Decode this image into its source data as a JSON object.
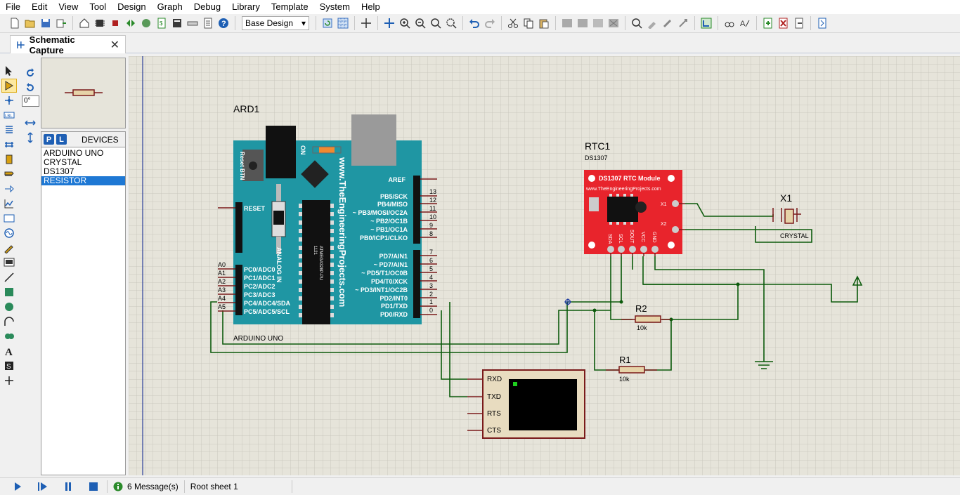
{
  "menu": [
    "File",
    "Edit",
    "View",
    "Tool",
    "Design",
    "Graph",
    "Debug",
    "Library",
    "Template",
    "System",
    "Help"
  ],
  "toolbar": {
    "design_select": "Base Design"
  },
  "tab": {
    "label": "Schematic Capture",
    "close": "✕"
  },
  "rotation": {
    "value": "0°"
  },
  "devices": {
    "p_label": "P",
    "l_label": "L",
    "header": "DEVICES",
    "items": [
      "ARDUINO UNO",
      "CRYSTAL",
      "DS1307",
      "RESISTOR"
    ],
    "selected": "RESISTOR"
  },
  "schematic": {
    "arduino": {
      "ref": "ARD1",
      "name": "ARDUINO UNO",
      "brand": "www.TheEngineeringProjects.com",
      "reset_btn": "Reset BTN",
      "on": "ON",
      "analog_in": "ANALOG IN",
      "chip": "ATMEGA328P-PU",
      "chip_num": "1121",
      "reset": "RESET",
      "aref": "AREF",
      "analog_pins": [
        "A0",
        "A1",
        "A2",
        "A3",
        "A4",
        "A5"
      ],
      "analog_labels": [
        "PC0/ADC0",
        "PC1/ADC1",
        "PC2/ADC2",
        "PC3/ADC3",
        "PC4/ADC4/SDA",
        "PC5/ADC5/SCL"
      ],
      "digital_high_labels": [
        "PB5/SCK",
        "PB4/MISO",
        "~ PB3/MOSI/OC2A",
        "~ PB2/OC1B",
        "~ PB1/OC1A",
        "PB0/ICP1/CLKO"
      ],
      "digital_high_nums": [
        "13",
        "12",
        "11",
        "10",
        "9",
        "8"
      ],
      "digital_low_labels": [
        "PD7/AIN1",
        "~ PD7/AIN1",
        "~ PD5/T1/OC0B",
        "PD4/T0/XCK",
        "~ PD3/INT1/OC2B",
        "PD2/INT0",
        "PD1/TXD",
        "PD0/RXD"
      ],
      "digital_low_nums": [
        "7",
        "6",
        "5",
        "4",
        "3",
        "2",
        "1",
        "0"
      ]
    },
    "rtc": {
      "ref": "RTC1",
      "part": "DS1307",
      "title": "DS1307 RTC Module",
      "url": "www.TheEngineeringProjects.com",
      "x1": "X1",
      "x2": "X2",
      "pins": [
        "SDA",
        "SCL",
        "SOUT",
        "VCC",
        "GND"
      ]
    },
    "crystal": {
      "ref": "X1",
      "name": "CRYSTAL"
    },
    "r1": {
      "ref": "R1",
      "value": "10k"
    },
    "r2": {
      "ref": "R2",
      "value": "10k"
    },
    "terminal": {
      "pins": [
        "RXD",
        "TXD",
        "RTS",
        "CTS"
      ]
    }
  },
  "status": {
    "messages": "6 Message(s)",
    "sheet": "Root sheet 1"
  },
  "colors": {
    "wire": "#0b5a0b",
    "arduino": "#1f96a3",
    "rtc": "#e8242c",
    "canvas": "#e6e4da",
    "grid": "#c9c7bd",
    "component": "#7a1a1a"
  }
}
